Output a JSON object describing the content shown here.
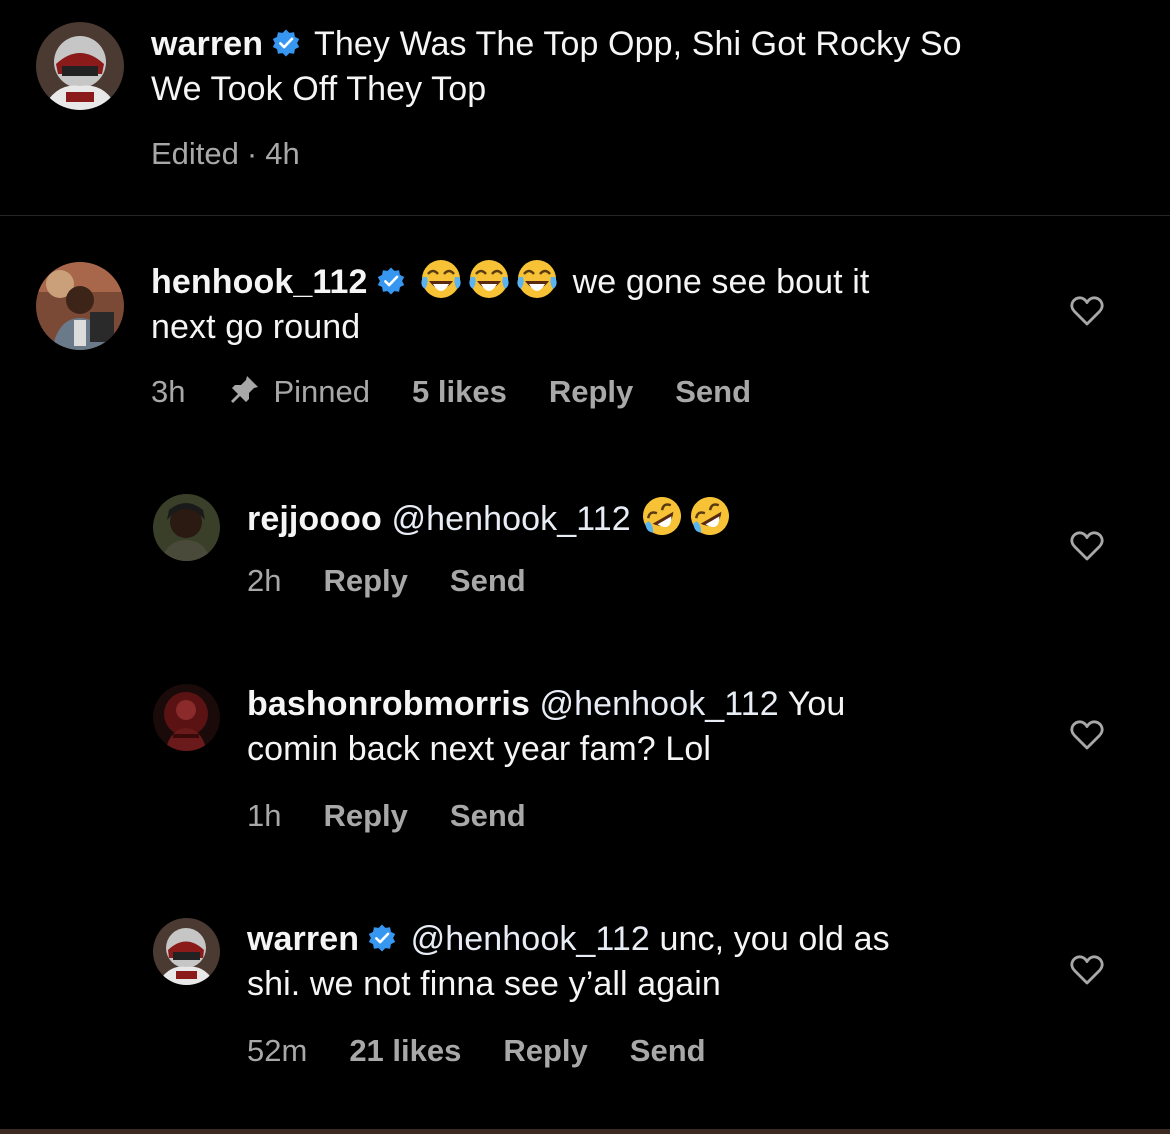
{
  "caption": {
    "username": "warren",
    "text_line1": "They Was The Top Opp, Shi Got Rocky So",
    "text_line2": "We Took Off They Top",
    "edited": "Edited",
    "time": "4h"
  },
  "comments": [
    {
      "username": "henhook_112",
      "verified": true,
      "emoji": [
        "face-with-tears-of-joy",
        "face-with-tears-of-joy",
        "face-with-tears-of-joy"
      ],
      "text_line1": "we gone see bout it",
      "text_line2": "next go round",
      "time": "3h",
      "pinned": "Pinned",
      "likes": "5 likes",
      "reply": "Reply",
      "send": "Send"
    },
    {
      "username": "rejjoooo",
      "mention": "@henhook_112",
      "emoji": [
        "rolling-on-floor-laughing",
        "rolling-on-floor-laughing"
      ],
      "time": "2h",
      "reply": "Reply",
      "send": "Send"
    },
    {
      "username": "bashonrobmorris",
      "mention": "@henhook_112",
      "text_line1": "You",
      "text_line2": "comin back next year fam? Lol",
      "time": "1h",
      "reply": "Reply",
      "send": "Send"
    },
    {
      "username": "warren",
      "verified": true,
      "mention": "@henhook_112",
      "text_line1": "unc, you old as",
      "text_line2": "shi. we not finna see y’all again",
      "time": "52m",
      "likes": "21 likes",
      "reply": "Reply",
      "send": "Send"
    }
  ],
  "colors": {
    "background": "#000000",
    "text": "#f5f5f5",
    "meta": "#a8a8a8",
    "verified": "#3797f0",
    "divider": "#262626"
  },
  "icons": [
    "verified-badge-icon",
    "pin-icon",
    "heart-icon",
    "avatar"
  ]
}
